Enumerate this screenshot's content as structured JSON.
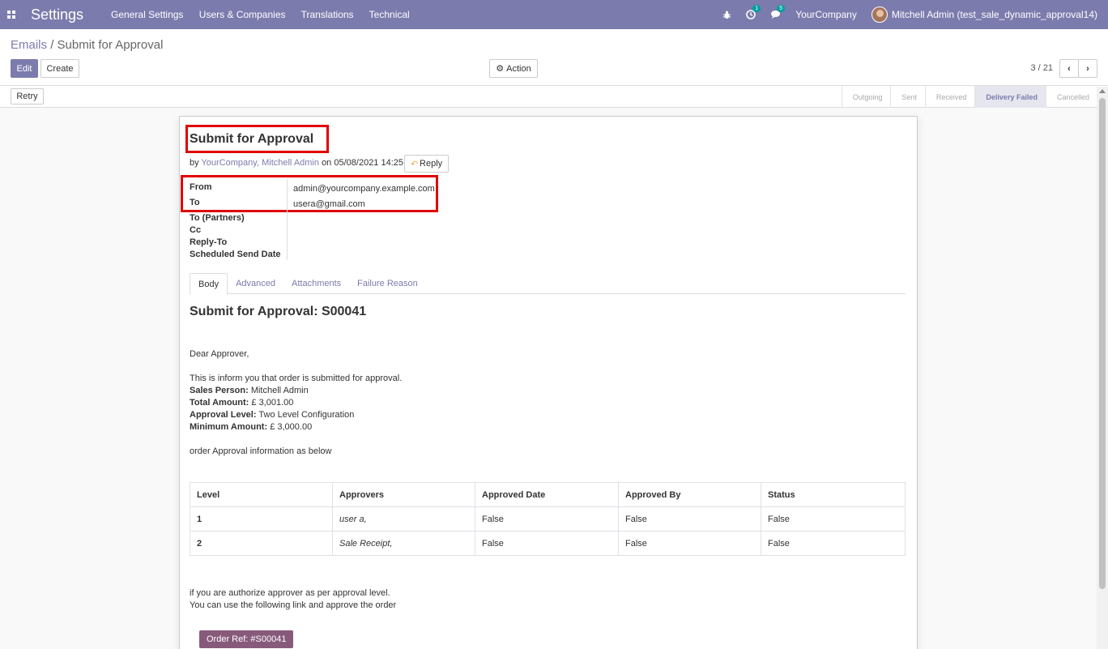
{
  "navbar": {
    "brand": "Settings",
    "menu": [
      "General Settings",
      "Users & Companies",
      "Translations",
      "Technical"
    ],
    "activity_count": "1",
    "messages_count": "5",
    "company": "YourCompany",
    "user": "Mitchell Admin (test_sale_dynamic_approval14)"
  },
  "breadcrumb": {
    "parent": "Emails",
    "separator": "/",
    "current": "Submit for Approval"
  },
  "buttons": {
    "edit": "Edit",
    "create": "Create",
    "action": "Action",
    "retry": "Retry",
    "reply": "Reply"
  },
  "pager": {
    "text": "3 / 21"
  },
  "stages": [
    "Outgoing",
    "Sent",
    "Received",
    "Delivery Failed",
    "Cancelled"
  ],
  "active_stage": "Delivery Failed",
  "email": {
    "subject": "Submit for Approval",
    "by_prefix": "by",
    "author": "YourCompany, Mitchell Admin",
    "date_prefix": "on",
    "date": "05/08/2021 14:25:11",
    "fields": {
      "from_label": "From",
      "to_label": "To",
      "to_partners_label": "To (Partners)",
      "cc_label": "Cc",
      "reply_to_label": "Reply-To",
      "scheduled_label": "Scheduled Send Date",
      "from_value": "admin@yourcompany.example.com",
      "to_value": "usera@gmail.com"
    }
  },
  "tabs": [
    "Body",
    "Advanced",
    "Attachments",
    "Failure Reason"
  ],
  "body": {
    "title": "Submit for Approval: S00041",
    "greeting": "Dear Approver,",
    "intro": "This is inform you that order is submitted for approval.",
    "sales_person_label": "Sales Person:",
    "sales_person": "Mitchell Admin",
    "total_label": "Total Amount:",
    "total": "£ 3,001.00",
    "level_label": "Approval Level:",
    "level": "Two Level Configuration",
    "min_label": "Minimum Amount:",
    "min": "£ 3,000.00",
    "info": "order Approval information as below",
    "table": {
      "headers": [
        "Level",
        "Approvers",
        "Approved Date",
        "Approved By",
        "Status"
      ],
      "rows": [
        [
          "1",
          "user a,",
          "False",
          "False",
          "False"
        ],
        [
          "2",
          "Sale Receipt,",
          "False",
          "False",
          "False"
        ]
      ]
    },
    "footer1": "if you are authorize approver as per approval level.",
    "footer2": "You can use the following link and approve the order",
    "order_ref": "Order Ref: #S00041"
  },
  "colors": {
    "primary": "#7c7bad",
    "highlight": "#e00000",
    "order_button": "#875a7b"
  }
}
